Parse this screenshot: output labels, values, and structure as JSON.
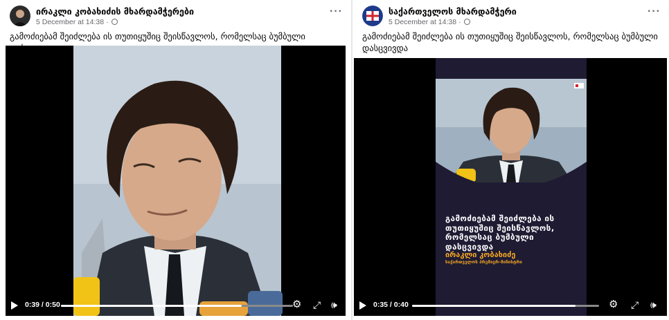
{
  "posts": [
    {
      "author": "ირაკლი კობახიძის მხარდამჭერები",
      "date": "5 December at 14:38",
      "separator": "·",
      "caption": "გამოძიებამ შეიძლება ის თუთიყუშიც შეისწავლოს, რომელსაც ბუმბული დასცვივდა",
      "video": {
        "time": "0:39 / 0:50",
        "progress": 0.78
      }
    },
    {
      "author": "საქართველოს მხარდამჭერი",
      "date": "5 December at 14:38",
      "separator": "·",
      "caption": "გამოძიებამ შეიძლება ის თუთიყუშიც შეისწავლოს, რომელსაც ბუმბული დასცვივდა",
      "video": {
        "time": "0:35 / 0:40",
        "progress": 0.875,
        "overlay_text": "გამოძიებამ შეიძლება ის თუთიყუშიც შეისწავლოს, რომელსაც ბუმბული დასცვივდა",
        "overlay_name": "ირაკლი კობახიძე",
        "overlay_role": "საქართველოს პრემიერ-მინისტრი"
      }
    }
  ],
  "icons": {
    "more": "more-icon",
    "globe": "globe-icon",
    "play": "play-icon",
    "settings": "gear-icon",
    "fullscreen": "fullscreen-icon",
    "volume": "volume-icon"
  },
  "colors": {
    "overlay_name": "#f5a623",
    "flag_red": "#d3232e",
    "flag_blue": "#1e3a8a"
  }
}
